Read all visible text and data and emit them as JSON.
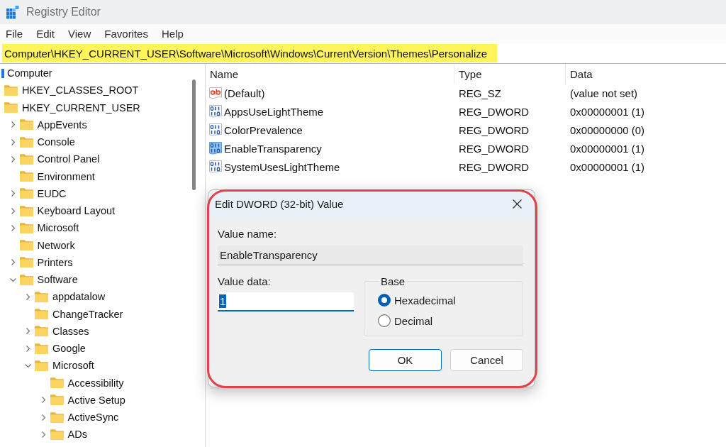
{
  "window": {
    "title": "Registry Editor"
  },
  "menu": [
    "File",
    "Edit",
    "View",
    "Favorites",
    "Help"
  ],
  "address_bar": {
    "path": "Computer\\HKEY_CURRENT_USER\\Software\\Microsoft\\Windows\\CurrentVersion\\Themes\\Personalize",
    "highlighted": true
  },
  "tree": [
    {
      "label": "Computer",
      "children": [
        {
          "label": "HKEY_CLASSES_ROOT"
        },
        {
          "label": "HKEY_CURRENT_USER",
          "children": [
            {
              "label": "AppEvents",
              "expanded": false
            },
            {
              "label": "Console",
              "expanded": false
            },
            {
              "label": "Control Panel",
              "expanded": false
            },
            {
              "label": "Environment"
            },
            {
              "label": "EUDC",
              "expanded": false
            },
            {
              "label": "Keyboard Layout",
              "expanded": false
            },
            {
              "label": "Microsoft",
              "expanded": false
            },
            {
              "label": "Network"
            },
            {
              "label": "Printers",
              "expanded": false
            },
            {
              "label": "Software",
              "expanded": true,
              "children": [
                {
                  "label": "appdatalow",
                  "expanded": false
                },
                {
                  "label": "ChangeTracker"
                },
                {
                  "label": "Classes",
                  "expanded": false
                },
                {
                  "label": "Google",
                  "expanded": false
                },
                {
                  "label": "Microsoft",
                  "expanded": true,
                  "children": [
                    {
                      "label": "Accessibility"
                    },
                    {
                      "label": "Active Setup",
                      "expanded": false
                    },
                    {
                      "label": "ActiveSync",
                      "expanded": false
                    },
                    {
                      "label": "ADs",
                      "expanded": false
                    }
                  ]
                }
              ]
            }
          ]
        }
      ]
    }
  ],
  "values": {
    "columns": [
      "Name",
      "Type",
      "Data"
    ],
    "rows": [
      {
        "kind": "string",
        "name": "(Default)",
        "type": "REG_SZ",
        "data": "(value not set)",
        "selected": false
      },
      {
        "kind": "dword",
        "name": "AppsUseLightTheme",
        "type": "REG_DWORD",
        "data": "0x00000001 (1)",
        "selected": false
      },
      {
        "kind": "dword",
        "name": "ColorPrevalence",
        "type": "REG_DWORD",
        "data": "0x00000000 (0)",
        "selected": false
      },
      {
        "kind": "dword",
        "name": "EnableTransparency",
        "type": "REG_DWORD",
        "data": "0x00000001 (1)",
        "selected": true
      },
      {
        "kind": "dword",
        "name": "SystemUsesLightTheme",
        "type": "REG_DWORD",
        "data": "0x00000001 (1)",
        "selected": false
      }
    ]
  },
  "dialog": {
    "title": "Edit DWORD (32-bit) Value",
    "highlighted": true,
    "value_name": {
      "label": "Value name:",
      "value": "EnableTransparency"
    },
    "value_data": {
      "label": "Value data:",
      "value": "1",
      "text_selected": true
    },
    "base": {
      "label": "Base",
      "options": [
        {
          "label": "Hexadecimal",
          "selected": true
        },
        {
          "label": "Decimal",
          "selected": false
        }
      ]
    },
    "buttons": [
      {
        "label": "OK",
        "default": true
      },
      {
        "label": "Cancel",
        "default": false
      }
    ]
  }
}
